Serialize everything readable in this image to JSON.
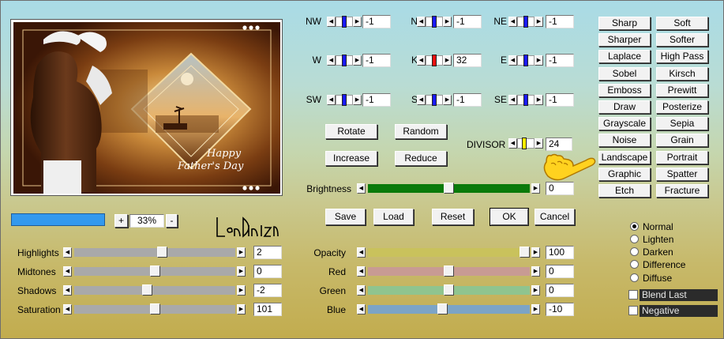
{
  "preview": {
    "greeting_line1": "Happy",
    "greeting_line2": "Father's Day",
    "zoom_plus": "+",
    "zoom_value": "33%",
    "zoom_minus": "-",
    "signature": "LeniDiniz"
  },
  "kernel": {
    "cells": [
      {
        "label": "NW",
        "value": "-1",
        "thumb_color": "#1a1aff",
        "thumb_pos": 0.5
      },
      {
        "label": "N",
        "value": "-1",
        "thumb_color": "#1a1aff",
        "thumb_pos": 0.5
      },
      {
        "label": "NE",
        "value": "-1",
        "thumb_color": "#1a1aff",
        "thumb_pos": 0.5
      },
      {
        "label": "W",
        "value": "-1",
        "thumb_color": "#1a1aff",
        "thumb_pos": 0.5
      },
      {
        "label": "K",
        "value": "32",
        "thumb_color": "#ee1111",
        "thumb_pos": 0.5
      },
      {
        "label": "E",
        "value": "-1",
        "thumb_color": "#1a1aff",
        "thumb_pos": 0.5
      },
      {
        "label": "SW",
        "value": "-1",
        "thumb_color": "#1a1aff",
        "thumb_pos": 0.5
      },
      {
        "label": "S",
        "value": "-1",
        "thumb_color": "#1a1aff",
        "thumb_pos": 0.5
      },
      {
        "label": "SE",
        "value": "-1",
        "thumb_color": "#1a1aff",
        "thumb_pos": 0.5
      }
    ]
  },
  "buttons": {
    "rotate": "Rotate",
    "random": "Random",
    "increase": "Increase",
    "reduce": "Reduce",
    "save": "Save",
    "load": "Load",
    "reset": "Reset",
    "ok": "OK",
    "cancel": "Cancel"
  },
  "divisor": {
    "label": "DIVISOR",
    "value": "24",
    "thumb_color": "#ffee00"
  },
  "brightness": {
    "label": "Brightness",
    "value": "0",
    "level": 0.5,
    "track_color": "#0a7a0a"
  },
  "filters": [
    [
      "Sharp",
      "Soft"
    ],
    [
      "Sharper",
      "Softer"
    ],
    [
      "Laplace",
      "High Pass"
    ],
    [
      "Sobel",
      "Kirsch"
    ],
    [
      "Emboss",
      "Prewitt"
    ],
    [
      "Draw",
      "Posterize"
    ],
    [
      "Grayscale",
      "Sepia"
    ],
    [
      "Noise",
      "Grain"
    ],
    [
      "Landscape",
      "Portrait"
    ],
    [
      "Graphic",
      "Spatter"
    ],
    [
      "Etch",
      "Fracture"
    ]
  ],
  "tones": [
    {
      "label": "Highlights",
      "value": "2",
      "level": 0.55
    },
    {
      "label": "Midtones",
      "value": "0",
      "level": 0.5
    },
    {
      "label": "Shadows",
      "value": "-2",
      "level": 0.45
    },
    {
      "label": "Saturation",
      "value": "101",
      "level": 0.5
    }
  ],
  "mix": [
    {
      "label": "Opacity",
      "value": "100",
      "level": 1.0,
      "track_color": "#c9c25c"
    },
    {
      "label": "Red",
      "value": "0",
      "level": 0.5,
      "track_color": "#c89b93"
    },
    {
      "label": "Green",
      "value": "0",
      "level": 0.5,
      "track_color": "#8fc48f"
    },
    {
      "label": "Blue",
      "value": "-10",
      "level": 0.46,
      "track_color": "#7ca4c6"
    }
  ],
  "blend_modes": [
    {
      "label": "Normal",
      "selected": true
    },
    {
      "label": "Lighten",
      "selected": false
    },
    {
      "label": "Darken",
      "selected": false
    },
    {
      "label": "Difference",
      "selected": false
    },
    {
      "label": "Diffuse",
      "selected": false
    }
  ],
  "options": [
    {
      "label": "Blend Last",
      "checked": false
    },
    {
      "label": "Negative",
      "checked": false
    }
  ],
  "colors": {
    "accent": "#3399ee",
    "dark_label_bg": "#2b2b2b"
  }
}
